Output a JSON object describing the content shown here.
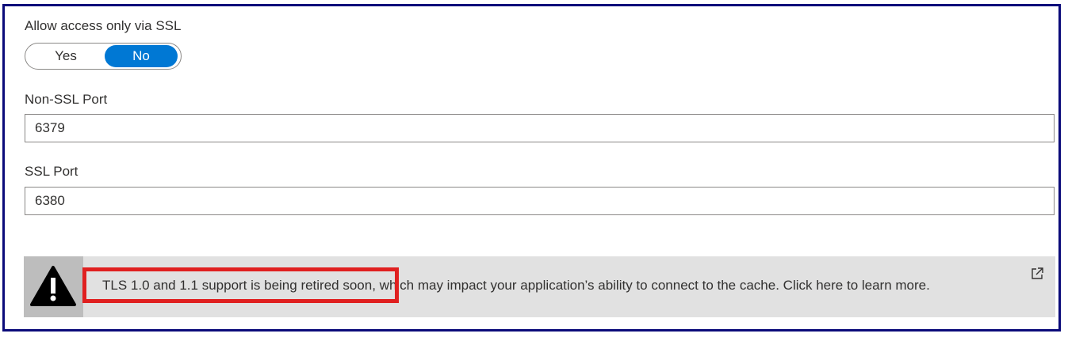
{
  "ssl_only": {
    "label": "Allow access only via SSL",
    "options": [
      "Yes",
      "No"
    ],
    "selected": "No"
  },
  "non_ssl_port": {
    "label": "Non-SSL Port",
    "value": "6379"
  },
  "ssl_port": {
    "label": "SSL Port",
    "value": "6380"
  },
  "banner": {
    "message": "TLS 1.0 and 1.1 support is being retired soon, which may impact your application’s ability to connect to the cache. Click here to learn more.",
    "icon": "warning-icon",
    "link_icon": "external-link-icon"
  },
  "colors": {
    "accent": "#0078d4",
    "highlight_box": "#e02020",
    "frame_border": "#0b0b7a",
    "banner_bg": "#e1e1e1"
  }
}
